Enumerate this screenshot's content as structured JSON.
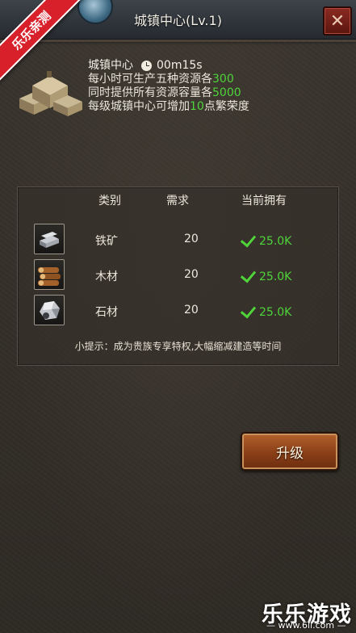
{
  "window": {
    "title": "城镇中心(Lv.1)",
    "close_glyph": "✕"
  },
  "ribbon": {
    "text": "乐乐亲测"
  },
  "building": {
    "name": "城镇中心",
    "timer": "00m15s",
    "line1_prefix": "每小时可生产五种资源各",
    "line1_value": "300",
    "line2_prefix": "同时提供所有资源容量各",
    "line2_value": "5000",
    "line3_prefix": "每级城镇中心可增加",
    "line3_value": "10",
    "line3_suffix": "点繁荣度"
  },
  "table": {
    "headers": {
      "category": "类别",
      "required": "需求",
      "owned": "当前拥有"
    },
    "rows": [
      {
        "icon": "iron-ore-icon",
        "name": "铁矿",
        "required": "20",
        "owned": "25.0K"
      },
      {
        "icon": "wood-icon",
        "name": "木材",
        "required": "20",
        "owned": "25.0K"
      },
      {
        "icon": "stone-icon",
        "name": "石材",
        "required": "20",
        "owned": "25.0K"
      }
    ],
    "tip": "小提示：成为贵族专享特权,大幅缩减建造等时间"
  },
  "actions": {
    "upgrade_label": "升级"
  },
  "watermark": {
    "brand": "乐乐游戏",
    "url": "— www.6ll.com —"
  },
  "colors": {
    "accent_green": "#4fd43a",
    "close_red": "#8a2a22",
    "button_orange": "#b4622d"
  }
}
